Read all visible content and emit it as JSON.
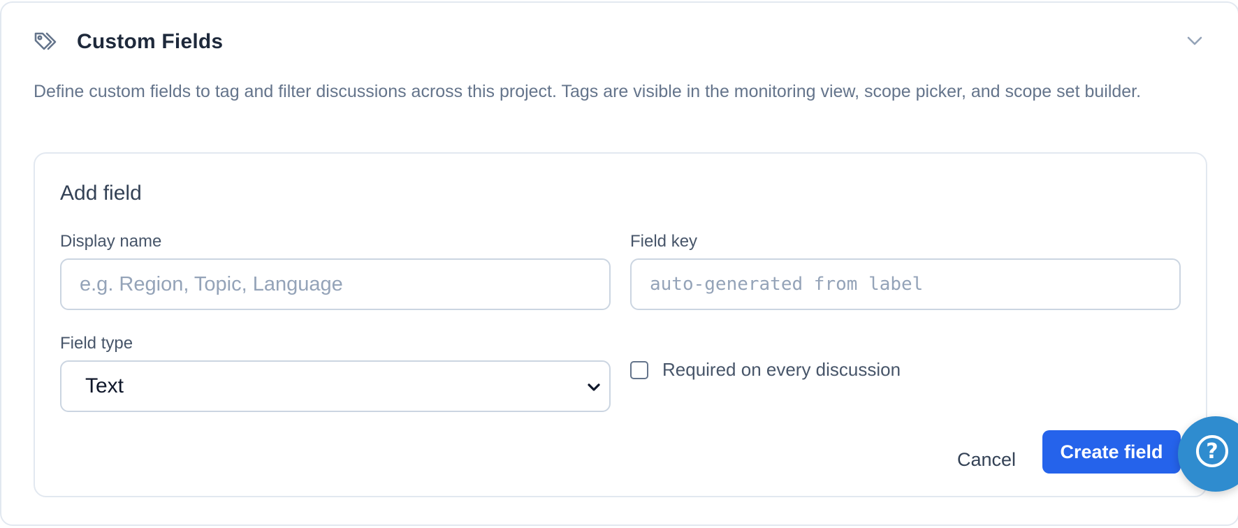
{
  "section": {
    "title": "Custom Fields",
    "icon": "tag-icon",
    "description": "Define custom fields to tag and filter discussions across this project. Tags are visible in the monitoring view, scope picker, and scope set builder."
  },
  "form": {
    "title": "Add field",
    "display_name": {
      "label": "Display name",
      "value": "",
      "placeholder": "e.g. Region, Topic, Language"
    },
    "field_key": {
      "label": "Field key",
      "value": "",
      "placeholder": "auto-generated from label"
    },
    "field_type": {
      "label": "Field type",
      "selected": "Text"
    },
    "required": {
      "label": "Required on every discussion",
      "checked": false
    },
    "cancel_label": "Cancel",
    "create_label": "Create field"
  },
  "help": {
    "symbol": "?"
  },
  "colors": {
    "primary": "#2563eb",
    "help_fab": "#2f8ccf",
    "muted_text": "#64748b",
    "border": "#e2e8f0"
  }
}
